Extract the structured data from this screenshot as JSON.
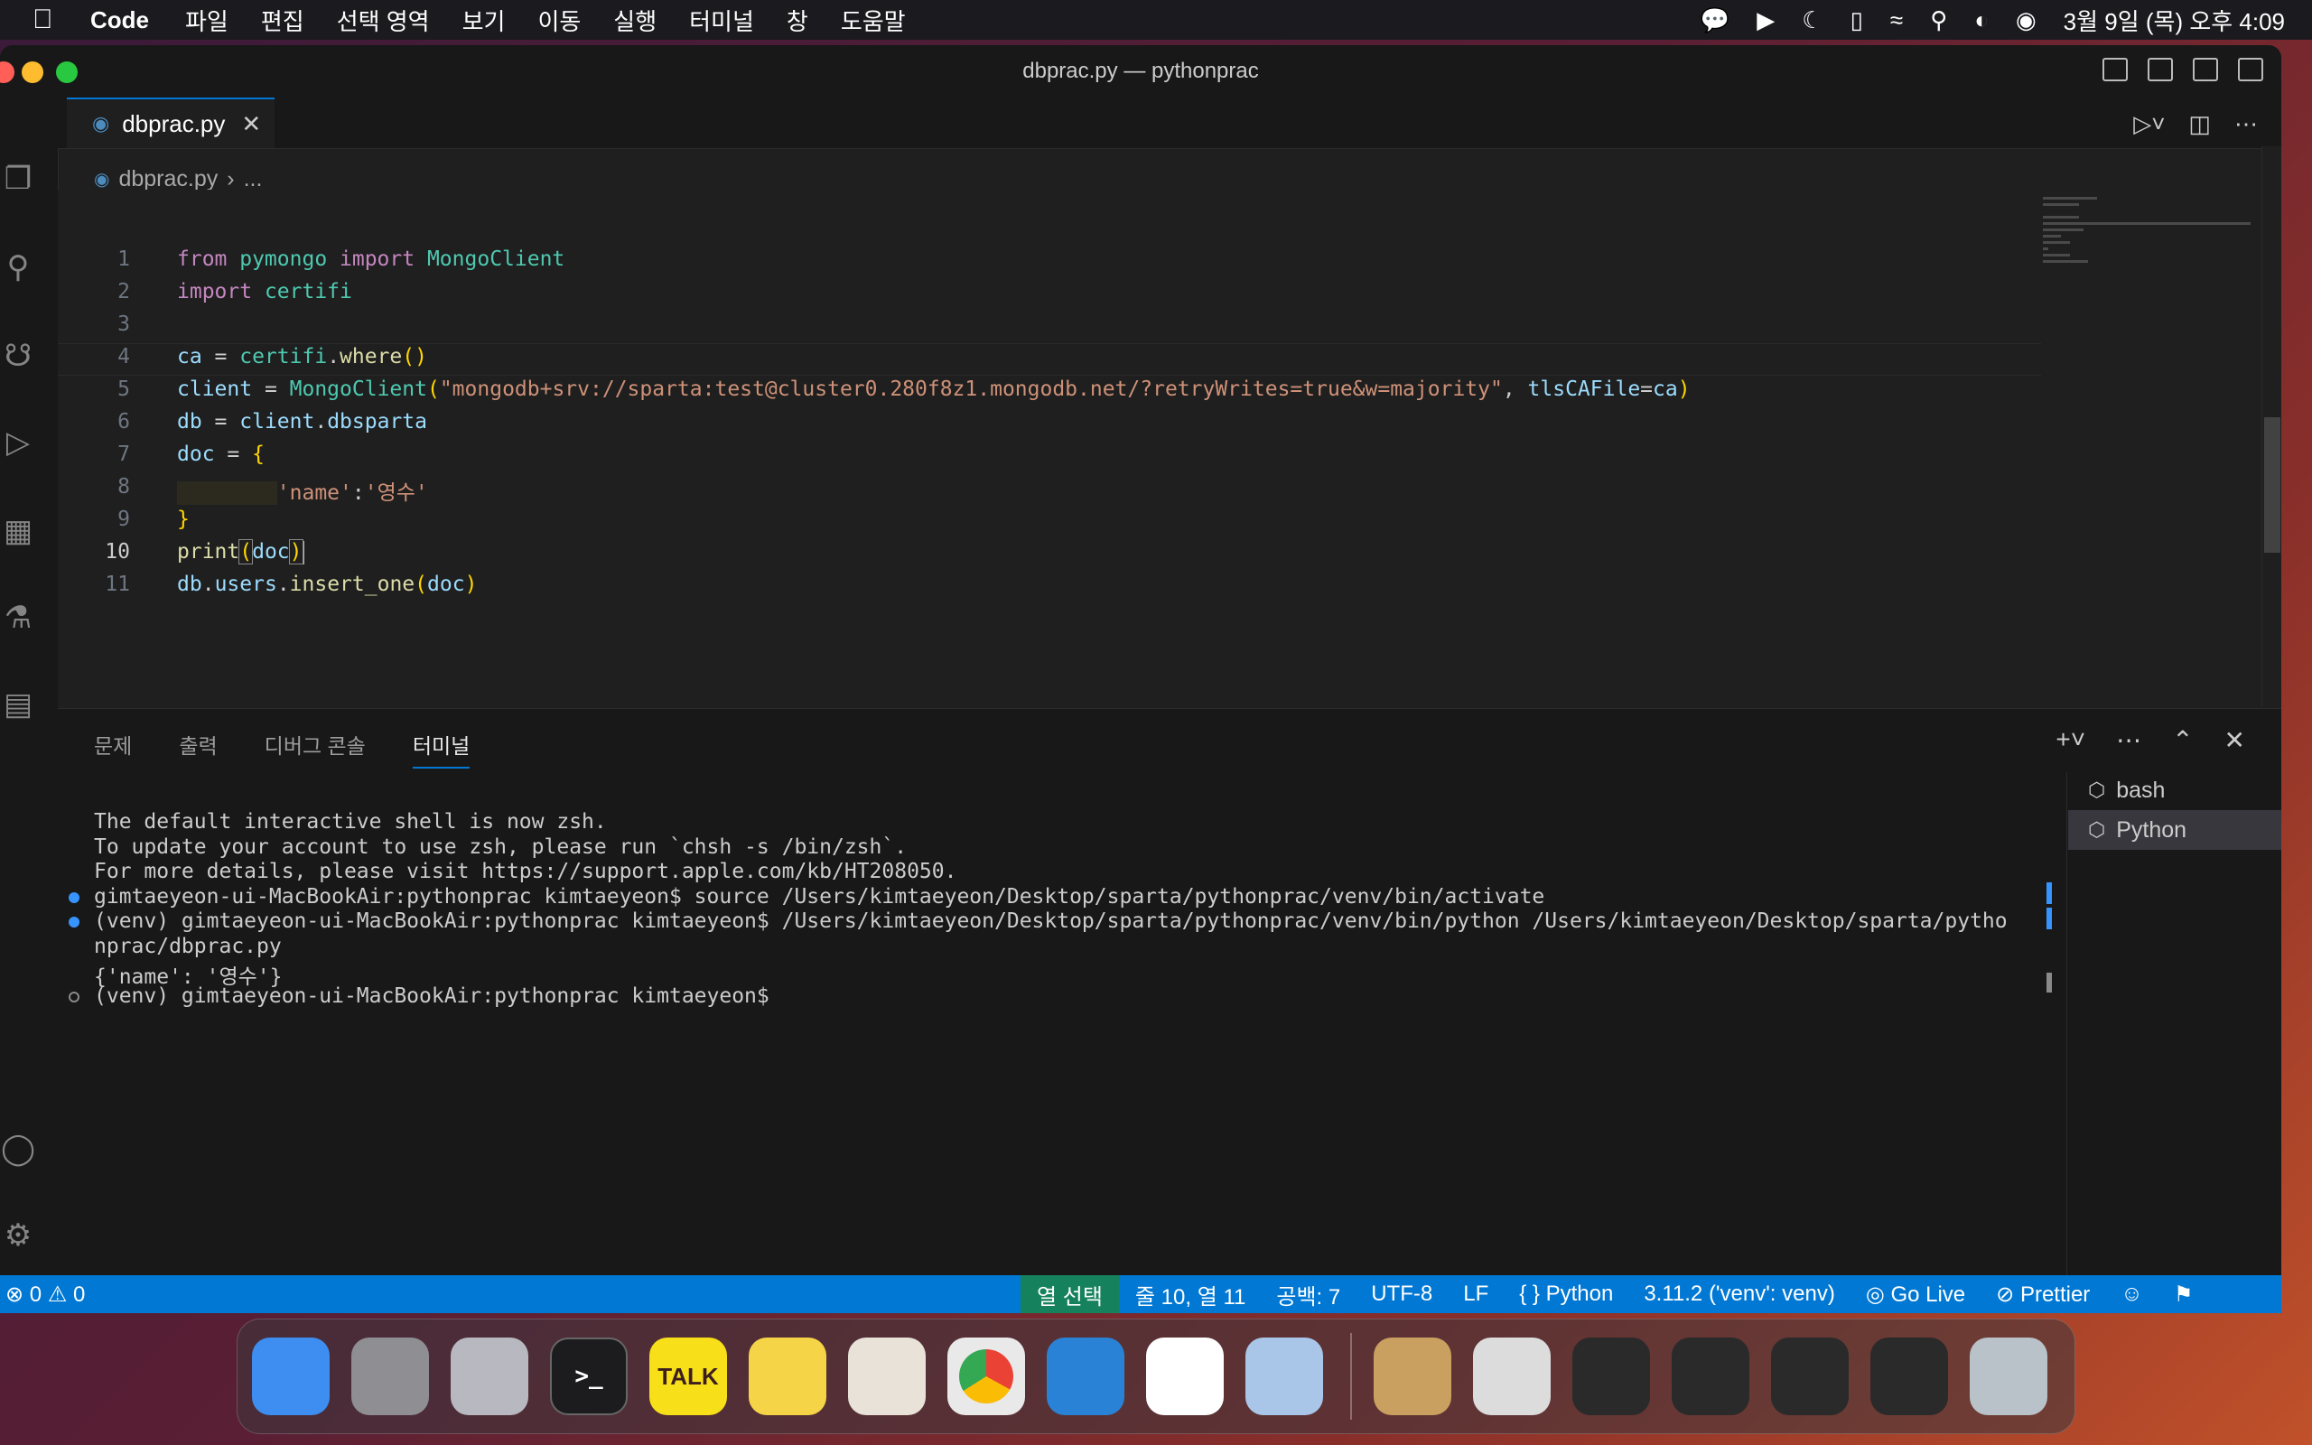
{
  "menubar": {
    "app": "Code",
    "items": [
      "파일",
      "편집",
      "선택 영역",
      "보기",
      "이동",
      "실행",
      "터미널",
      "창",
      "도움말"
    ],
    "clock": "3월 9일 (목) 오후 4:09"
  },
  "window": {
    "title": "dbprac.py — pythonprac"
  },
  "tab": {
    "label": "dbprac.py",
    "close": "✕"
  },
  "breadcrumb": {
    "file": "dbprac.py",
    "sep": "›",
    "more": "..."
  },
  "editor": {
    "active_line": 10,
    "lines": [
      {
        "n": "1"
      },
      {
        "n": "2"
      },
      {
        "n": "3"
      },
      {
        "n": "4"
      },
      {
        "n": "5"
      },
      {
        "n": "6"
      },
      {
        "n": "7"
      },
      {
        "n": "8"
      },
      {
        "n": "9"
      },
      {
        "n": "10"
      },
      {
        "n": "11"
      }
    ],
    "tokens": {
      "l1": [
        "from",
        " pymongo ",
        "import",
        " MongoClient"
      ],
      "l2": [
        "import",
        " certifi"
      ],
      "l4": [
        "ca",
        " = ",
        "certifi",
        ".",
        "where",
        "()"
      ],
      "l5": [
        "client",
        " = ",
        "MongoClient",
        "(",
        "\"mongodb+srv://sparta:test@cluster0.280f8z1.mongodb.net/?retryWrites=true&w=majority\"",
        ", ",
        "tlsCAFile",
        "=",
        "ca",
        ")"
      ],
      "l6": [
        "db",
        " = ",
        "client",
        ".",
        "dbsparta"
      ],
      "l7": [
        "doc",
        " = ",
        "{"
      ],
      "l8": [
        "        ",
        "'name'",
        ":",
        "'영수'"
      ],
      "l9": [
        "}"
      ],
      "l10": [
        "print",
        "(",
        "doc",
        ")"
      ],
      "l11": [
        "db",
        ".",
        "users",
        ".",
        "insert_one",
        "(",
        "doc",
        ")"
      ]
    }
  },
  "panel": {
    "tabs": [
      "문제",
      "출력",
      "디버그 콘솔",
      "터미널"
    ],
    "active_tab": "터미널",
    "terminal_lines": [
      {
        "text": "The default interactive shell is now zsh.",
        "marker": ""
      },
      {
        "text": "To update your account to use zsh, please run `chsh -s /bin/zsh`.",
        "marker": ""
      },
      {
        "text": "For more details, please visit https://support.apple.com/kb/HT208050.",
        "marker": ""
      },
      {
        "text": "gimtaeyeon-ui-MacBookAir:pythonprac kimtaeyeon$ source /Users/kimtaeyeon/Desktop/sparta/pythonprac/venv/bin/activate",
        "marker": "blue"
      },
      {
        "text": "(venv) gimtaeyeon-ui-MacBookAir:pythonprac kimtaeyeon$ /Users/kimtaeyeon/Desktop/sparta/pythonprac/venv/bin/python /Users/kimtaeyeon/Desktop/sparta/pytho",
        "marker": "blue"
      },
      {
        "text": "nprac/dbprac.py",
        "marker": ""
      },
      {
        "text": "{'name': '영수'}",
        "marker": ""
      },
      {
        "text": "(venv) gimtaeyeon-ui-MacBookAir:pythonprac kimtaeyeon$ ",
        "marker": "hollow"
      }
    ],
    "terminals": [
      {
        "label": "bash",
        "selected": false
      },
      {
        "label": "Python",
        "selected": true
      }
    ]
  },
  "statusbar": {
    "errors": "0",
    "warnings": "0",
    "selection_mode": "열 선택",
    "position": "줄 10, 열 11",
    "spaces": "공백: 7",
    "encoding": "UTF-8",
    "eol": "LF",
    "language": "Python",
    "interpreter": "3.11.2 ('venv': venv)",
    "golive": "Go Live",
    "prettier": "Prettier"
  },
  "dock": {
    "apps": [
      {
        "name": "finder",
        "color": "#3d8ef0",
        "label": ""
      },
      {
        "name": "system-settings",
        "color": "#8e8e93",
        "label": ""
      },
      {
        "name": "launchpad",
        "color": "#b8b8c0",
        "label": ""
      },
      {
        "name": "terminal",
        "color": "#1c1c1e",
        "label": ""
      },
      {
        "name": "kakaotalk",
        "color": "#f7e019",
        "label": "TALK"
      },
      {
        "name": "notes",
        "color": "#f5d547",
        "label": ""
      },
      {
        "name": "cyberduck",
        "color": "#e8e2d8",
        "label": ""
      },
      {
        "name": "chrome",
        "color": "#e9e9e9",
        "label": ""
      },
      {
        "name": "vscode",
        "color": "#2a82d6",
        "label": ""
      },
      {
        "name": "slack",
        "color": "#ffffff",
        "label": ""
      },
      {
        "name": "preview",
        "color": "#a9c6e8",
        "label": ""
      }
    ],
    "recents": [
      {
        "name": "archive-utility",
        "color": "#c9a060"
      },
      {
        "name": "window-thumb-1",
        "color": "#dcdcdc"
      },
      {
        "name": "window-thumb-2",
        "color": "#2a2a2a"
      },
      {
        "name": "window-thumb-3",
        "color": "#2a2a2a"
      },
      {
        "name": "window-thumb-4",
        "color": "#2a2a2a"
      },
      {
        "name": "window-thumb-5",
        "color": "#2a2a2a"
      },
      {
        "name": "trash",
        "color": "#b9c2c8"
      }
    ]
  }
}
